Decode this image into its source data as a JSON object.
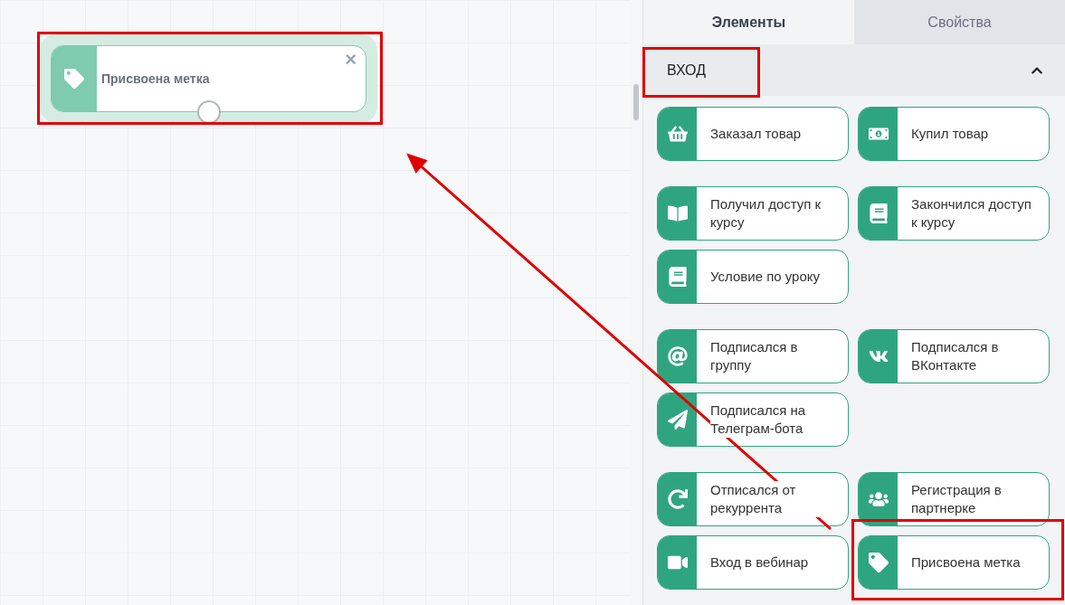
{
  "canvas": {
    "nodes": [
      {
        "label": "Присвоена метка",
        "selected": true,
        "close": "×"
      }
    ]
  },
  "tabs": [
    {
      "label": "Элементы",
      "selected": true
    },
    {
      "label": "Свойства",
      "selected": false
    }
  ],
  "section": {
    "title": "ВХОД",
    "expanded": true,
    "groups": [
      {
        "items": [
          "Заказал товар",
          "Купил товар"
        ]
      },
      {
        "items": [
          "Получил доступ к курсу",
          "Закончился доступ к курсу",
          "Условие по уроку"
        ]
      },
      {
        "items": [
          "Подписался в группу",
          "Подписался в ВКонтакте",
          "Подписался на Телеграм-бота"
        ]
      },
      {
        "items": [
          "Отписался от рекуррента",
          "Регистрация в партнерке",
          "Вход в вебинар",
          "Присвоена метка"
        ]
      }
    ]
  }
}
